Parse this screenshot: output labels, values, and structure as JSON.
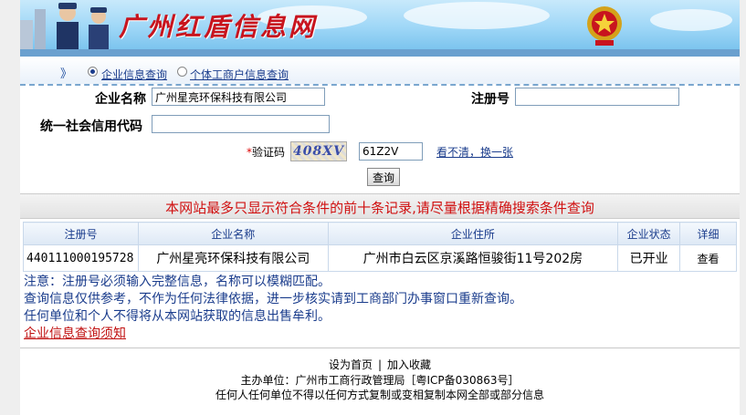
{
  "banner": {
    "title": "广州红盾信息网"
  },
  "search_type": {
    "arrows": "》",
    "options": [
      {
        "label": "企业信息查询",
        "selected": true
      },
      {
        "label": "个体工商户信息查询",
        "selected": false
      }
    ]
  },
  "form": {
    "company_name_label": "企业名称",
    "company_name_value": "广州星亮环保科技有限公司",
    "reg_no_label": "注册号",
    "reg_no_value": "",
    "credit_code_label": "统一社会信用代码",
    "credit_code_value": "",
    "captcha_required": "*",
    "captcha_label": "验证码",
    "captcha_image_text": "408XV",
    "captcha_value": "61Z2V",
    "refresh_link": "看不清，换一张",
    "query_button": "查询"
  },
  "notice": "本网站最多只显示符合条件的前十条记录,请尽量根据精确搜索条件查询",
  "table": {
    "headers": [
      "注册号",
      "企业名称",
      "企业住所",
      "企业状态",
      "详细"
    ],
    "rows": [
      [
        "440111000195728",
        "广州星亮环保科技有限公司",
        "广州市白云区京溪路恒骏街11号202房",
        "已开业",
        "查看"
      ]
    ]
  },
  "notes": {
    "line1": "注意：注册号必须输入完整信息，名称可以模糊匹配。",
    "line2": "查询信息仅供参考，不作为任何法律依据，进一步核实请到工商部门办事窗口重新查询。",
    "line3": "任何单位和个人不得将从本网站获取的信息出售牟利。",
    "link": "企业信息查询须知"
  },
  "footer": {
    "set_home": "设为首页",
    "separator": "|",
    "add_favorite": "加入收藏",
    "sponsor": "主办单位：广州市工商行政管理局［粤ICP备030863号］",
    "copyright": "任何人任何单位不得以任何方式复制或变相复制本网全部或部分信息"
  },
  "colors": {
    "banner_title": "#c8141e",
    "notice_text": "#d01010",
    "link_blue": "#1a3c8c",
    "header_bar": "#6aa0cf"
  }
}
